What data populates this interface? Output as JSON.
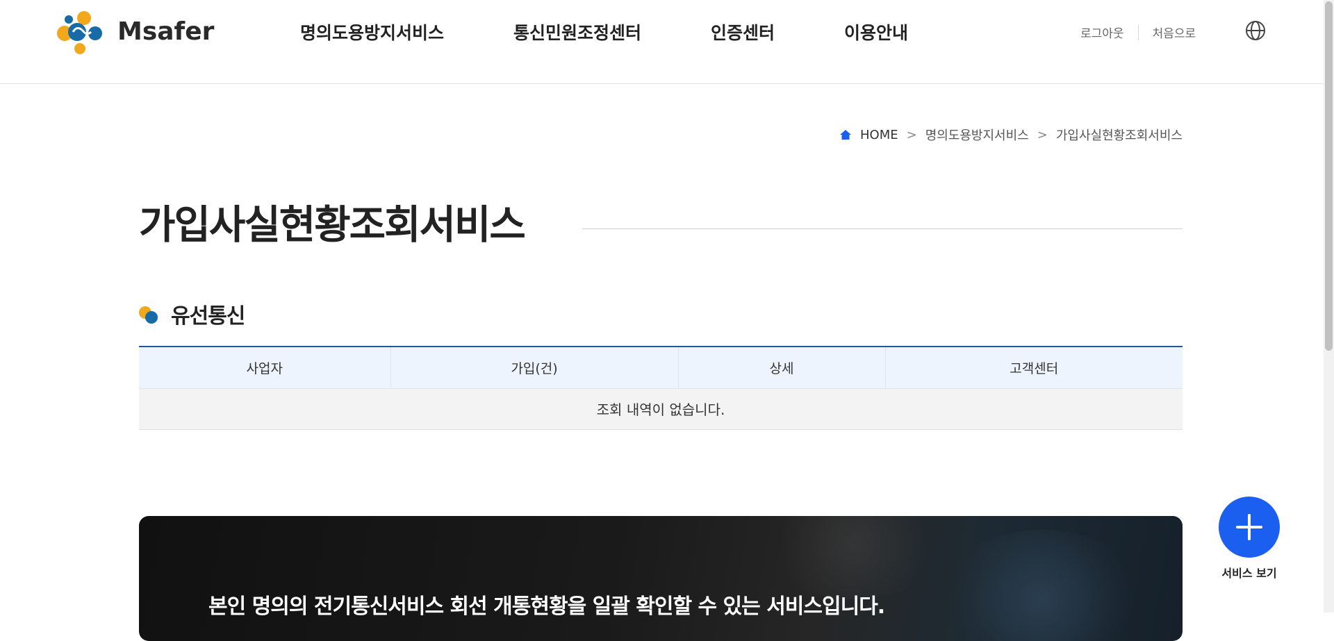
{
  "header": {
    "logo_text": "Msafer",
    "nav": [
      {
        "label": "명의도용방지서비스"
      },
      {
        "label": "통신민원조정센터"
      },
      {
        "label": "인증센터"
      },
      {
        "label": "이용안내"
      }
    ],
    "util": {
      "logout": "로그아웃",
      "home": "처음으로"
    },
    "globe_icon": "globe-icon"
  },
  "breadcrumb": {
    "home": "HOME",
    "items": [
      "명의도용방지서비스",
      "가입사실현황조회서비스"
    ],
    "separator": ">"
  },
  "page": {
    "title": "가입사실현황조회서비스"
  },
  "section": {
    "title": "유선통신"
  },
  "table": {
    "headers": [
      "사업자",
      "가입(건)",
      "상세",
      "고객센터"
    ],
    "empty_message": "조회 내역이 없습니다."
  },
  "banner": {
    "text": "본인 명의의 전기통신서비스 회선 개통현황을 일괄 확인할 수 있는 서비스입니다."
  },
  "fab": {
    "label": "서비스 보기",
    "icon": "plus-icon"
  },
  "colors": {
    "primary": "#1a5ff0",
    "table_top_border": "#1d56a4",
    "table_header_bg": "#eef4fd",
    "logo_orange": "#f2a81d",
    "logo_blue": "#176ca8"
  }
}
